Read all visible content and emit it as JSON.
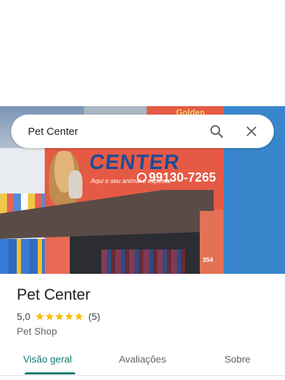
{
  "search": {
    "query": "Pet Center"
  },
  "photo": {
    "sign_brand": "CENTER",
    "sign_tagline": "Aqui o seu animal é especial",
    "sign_phone": "99130-7265",
    "sign_top": "Golden",
    "pillar_number": "354"
  },
  "place": {
    "name": "Pet Center",
    "rating": "5,0",
    "stars": 5,
    "reviews": "(5)",
    "category": "Pet Shop"
  },
  "tabs": [
    {
      "label": "Visão geral",
      "active": true
    },
    {
      "label": "Avaliações",
      "active": false
    },
    {
      "label": "Sobre",
      "active": false
    }
  ],
  "colors": {
    "accent": "#0b7a70",
    "star": "#fbbc04"
  },
  "icons": {
    "search": "search-icon",
    "close": "close-icon",
    "whatsapp": "whatsapp-icon",
    "star": "star-icon"
  }
}
